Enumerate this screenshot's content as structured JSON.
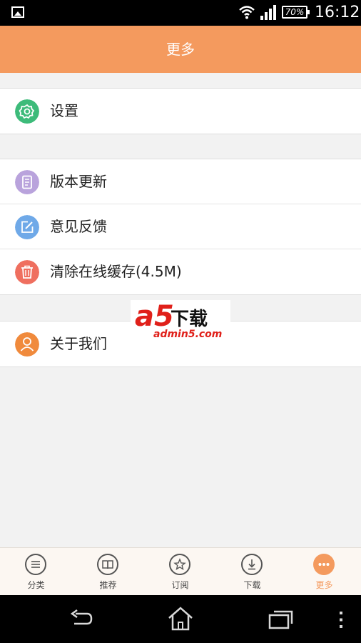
{
  "status_bar": {
    "battery": "70%",
    "time": "16:12"
  },
  "header": {
    "title": "更多"
  },
  "menu": {
    "group1": [
      {
        "label": "设置",
        "icon": "gear-icon",
        "color": "#3dbb7a"
      }
    ],
    "group2": [
      {
        "label": "版本更新",
        "icon": "document-icon",
        "color": "#b9a3dc"
      },
      {
        "label": "意见反馈",
        "icon": "edit-icon",
        "color": "#6fa9e8"
      },
      {
        "label": "清除在线缓存(4.5M)",
        "icon": "trash-icon",
        "color": "#ef6f5f"
      }
    ],
    "group3": [
      {
        "label": "关于我们",
        "icon": "person-icon",
        "color": "#f08a3c"
      }
    ]
  },
  "watermark": {
    "logo": "a5",
    "text": "下载",
    "url": "admin5.com"
  },
  "tabbar": {
    "items": [
      {
        "label": "分类",
        "icon": "menu-lines-icon"
      },
      {
        "label": "推荐",
        "icon": "book-icon"
      },
      {
        "label": "订阅",
        "icon": "star-icon"
      },
      {
        "label": "下载",
        "icon": "download-icon"
      },
      {
        "label": "更多",
        "icon": "more-dots-icon",
        "active": true
      }
    ],
    "active_color": "#f49a5e"
  },
  "nav": {
    "back": "back-icon",
    "home": "home-icon",
    "recent": "recent-apps-icon",
    "menu": "overflow-menu-icon"
  }
}
